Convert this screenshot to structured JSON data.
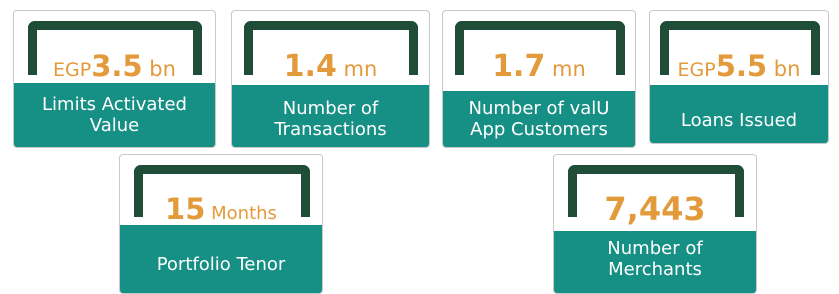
{
  "colors": {
    "bracket": "#1f4d38",
    "label_bg": "#168f84",
    "value": "#e39a3b"
  },
  "cards": [
    {
      "prefix": "EGP",
      "value": "3.5",
      "unit": " bn",
      "label_lines": [
        "Limits Activated",
        "Value"
      ]
    },
    {
      "prefix": "",
      "value": "1.4",
      "unit": " mn",
      "label_lines": [
        "Number of",
        "Transactions"
      ]
    },
    {
      "prefix": "",
      "value": "1.7",
      "unit": " mn",
      "label_lines": [
        "Number of valU",
        "App Customers"
      ]
    },
    {
      "prefix": "EGP",
      "value": "5.5",
      "unit": " bn",
      "label_lines": [
        "Loans Issued"
      ]
    },
    {
      "prefix": "",
      "value": "15",
      "unit": " Months",
      "label_lines": [
        "Portfolio Tenor"
      ]
    },
    {
      "prefix": "",
      "value": "7,443",
      "unit": "",
      "label_lines": [
        "Number of",
        "Merchants"
      ]
    }
  ]
}
